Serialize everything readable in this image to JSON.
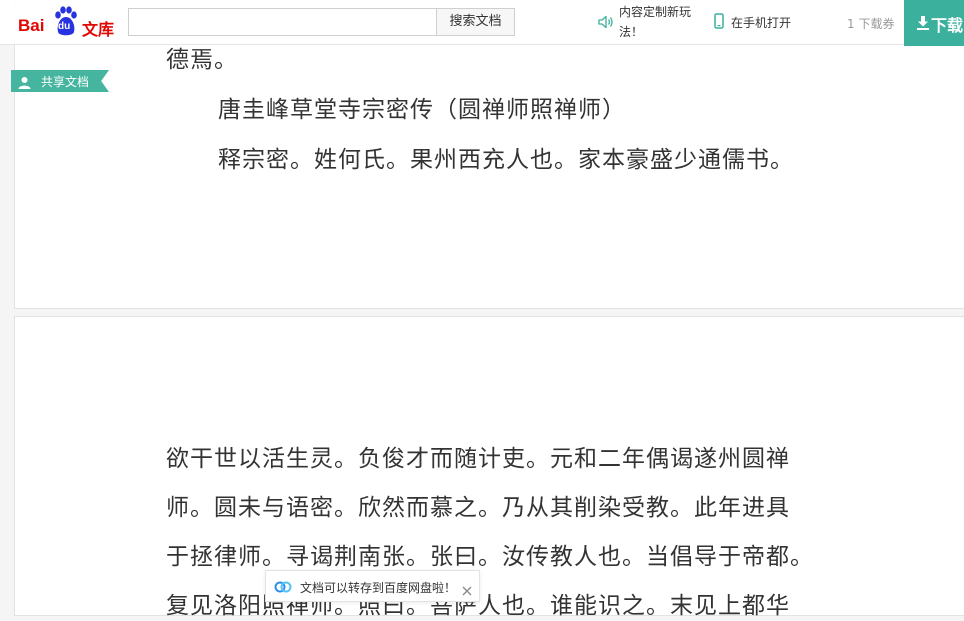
{
  "header": {
    "logo": {
      "part1": "Bai",
      "part2": "du",
      "part3": "文库"
    },
    "search": {
      "value": "",
      "placeholder": "",
      "button_label": "搜索文档"
    },
    "custom_label": "内容定制新玩法！",
    "mobile_label": "在手机打开",
    "coupon_label": "1 下载券",
    "download_label": "下载"
  },
  "share_tag": {
    "label": "共享文档"
  },
  "document": {
    "page1_lines": [
      "德焉。",
      "唐圭峰草堂寺宗密传（圆禅师照禅师）",
      "释宗密。姓何氏。果州西充人也。家本豪盛少通儒书。"
    ],
    "page2_lines": [
      "欲干世以活生灵。负俊才而随计吏。元和二年偶谒遂州圆禅",
      "师。圆未与语密。欣然而慕之。乃从其削染受教。此年进具",
      "于拯律师。寻谒荆南张。张曰。汝传教人也。当倡导于帝都。",
      "复见洛阳照禅师。照曰。菩萨人也。谁能识之。末见上都华"
    ]
  },
  "toast": {
    "label": "文档可以转存到百度网盘啦！"
  },
  "colors": {
    "brand_red": "#e10602",
    "paw_blue": "#2932e1",
    "accent_green": "#3ab09d"
  }
}
